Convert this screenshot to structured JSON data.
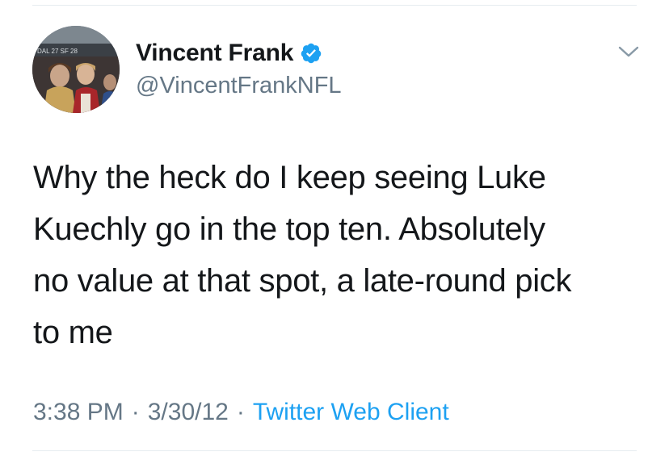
{
  "author": {
    "display_name": "Vincent Frank",
    "handle": "@VincentFrankNFL",
    "verified": true
  },
  "avatar_sign_text": "DAL 27 SF 28",
  "tweet": {
    "text": "Why the heck do I keep seeing Luke\nKuechly go in the top ten. Absolutely\nno value at that spot, a late-round pick\nto me"
  },
  "meta": {
    "time": "3:38 PM",
    "separator": "·",
    "date": "3/30/12",
    "source": "Twitter Web Client"
  },
  "colors": {
    "text": "#14171a",
    "secondary": "#657786",
    "link": "#1da1f2",
    "verified": "#1da1f2",
    "divider": "#e6ecf0"
  },
  "icons": {
    "verified": "verified-badge-icon",
    "menu": "chevron-down-icon"
  }
}
